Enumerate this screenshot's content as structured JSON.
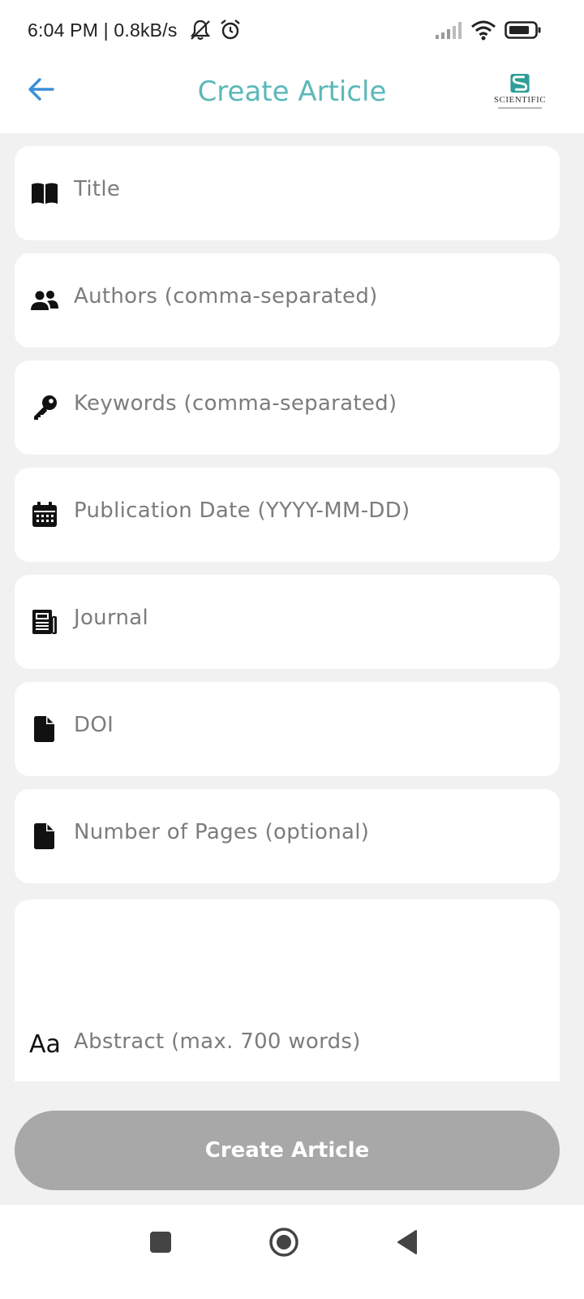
{
  "status_bar": {
    "text": "6:04 PM | 0.8kB/s",
    "icons": [
      "muted-bell-icon",
      "alarm-clock-icon",
      "signal-icon",
      "wifi-icon",
      "battery-icon"
    ]
  },
  "app_bar": {
    "title": "Create Article",
    "back_icon": "arrow-left-icon",
    "logo_text": "SCIENTIFIC"
  },
  "form": {
    "fields": [
      {
        "icon": "book-icon",
        "placeholder": "Title",
        "value": ""
      },
      {
        "icon": "people-icon",
        "placeholder": "Authors (comma-separated)",
        "value": ""
      },
      {
        "icon": "key-icon",
        "placeholder": "Keywords (comma-separated)",
        "value": ""
      },
      {
        "icon": "calendar-icon",
        "placeholder": "Publication Date (YYYY-MM-DD)",
        "value": ""
      },
      {
        "icon": "newspaper-icon",
        "placeholder": "Journal",
        "value": ""
      },
      {
        "icon": "document-icon",
        "placeholder": "DOI",
        "value": ""
      },
      {
        "icon": "document-icon",
        "placeholder": "Number of Pages (optional)",
        "value": ""
      }
    ],
    "abstract": {
      "icon_text": "Aa",
      "placeholder": "Abstract (max. 700 words)",
      "value": ""
    }
  },
  "submit_button": {
    "label": "Create Article",
    "enabled": false
  },
  "colors": {
    "accent": "#5bb8b8",
    "back_arrow": "#3a8fd8",
    "background": "#f1f1f1",
    "field_bg": "#ffffff",
    "placeholder": "#7c7c7c",
    "button_disabled": "#a8a8a8"
  },
  "nav_bar": {
    "icons": [
      "recents-square-icon",
      "home-circle-icon",
      "back-triangle-icon"
    ]
  }
}
